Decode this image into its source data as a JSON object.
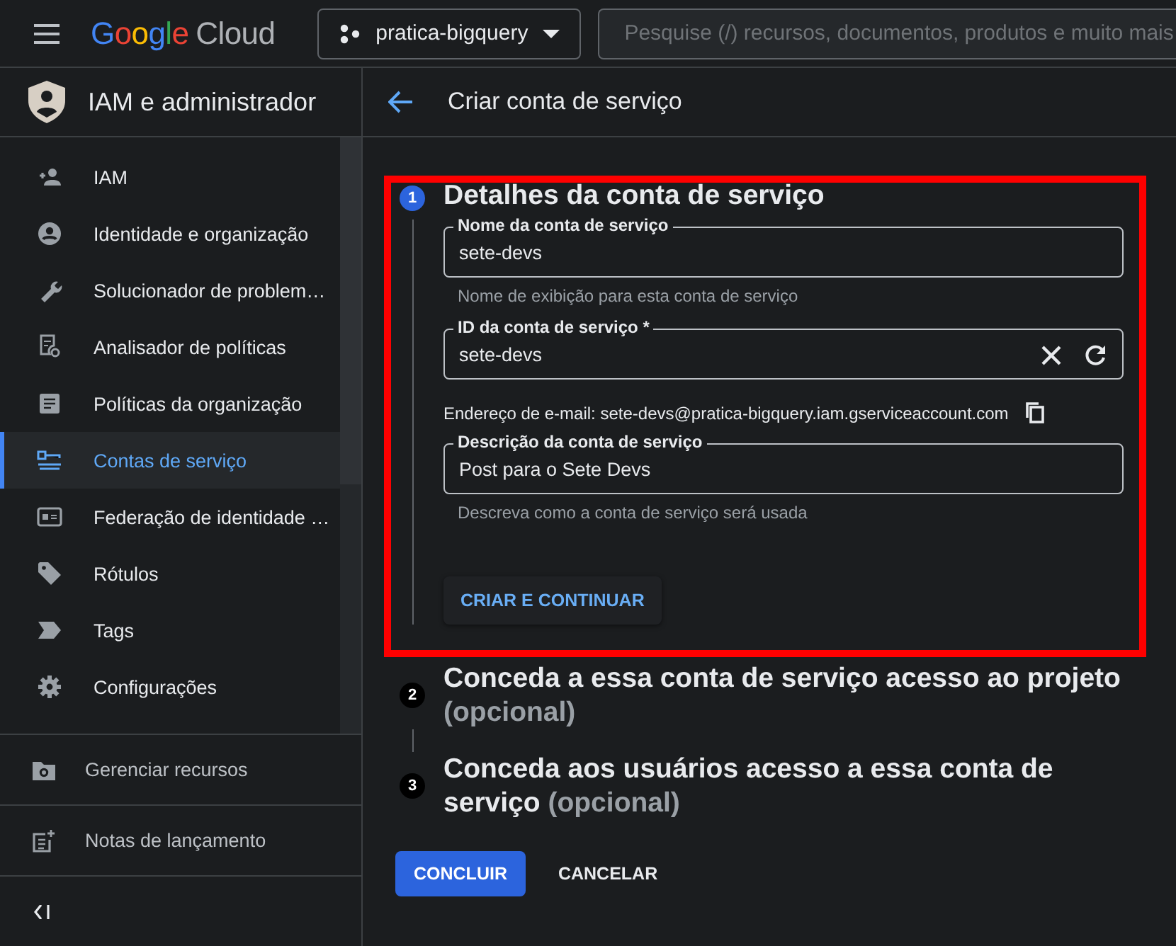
{
  "topbar": {
    "logo_brand": "Google",
    "logo_product": "Cloud",
    "project": "pratica-bigquery",
    "search": {
      "placeholder": "Pesquise (/) recursos, documentos, produtos e muito mais"
    }
  },
  "sidebar": {
    "title": "IAM e administrador",
    "items": [
      {
        "label": "IAM",
        "selected": false
      },
      {
        "label": "Identidade e organização",
        "selected": false
      },
      {
        "label": "Solucionador de problem…",
        "selected": false
      },
      {
        "label": "Analisador de políticas",
        "selected": false
      },
      {
        "label": "Políticas da organização",
        "selected": false
      },
      {
        "label": "Contas de serviço",
        "selected": true
      },
      {
        "label": "Federação de identidade …",
        "selected": false
      },
      {
        "label": "Rótulos",
        "selected": false
      },
      {
        "label": "Tags",
        "selected": false
      },
      {
        "label": "Configurações",
        "selected": false
      }
    ],
    "footer": [
      {
        "label": "Gerenciar recursos"
      },
      {
        "label": "Notas de lançamento"
      }
    ]
  },
  "page": {
    "title": "Criar conta de serviço"
  },
  "steps": [
    {
      "number": "1",
      "title": "Detalhes da conta de serviço",
      "active": true,
      "fields": [
        {
          "kind": "text",
          "label": "Nome da conta de serviço",
          "value": "sete-devs",
          "hint": "Nome de exibição para esta conta de serviço"
        },
        {
          "kind": "clearable",
          "label": "ID da conta de serviço *",
          "value": "sete-devs"
        },
        {
          "kind": "email",
          "text": "Endereço de e-mail: sete-devs@pratica-bigquery.iam.gserviceaccount.com"
        },
        {
          "kind": "text",
          "label": "Descrição da conta de serviço",
          "value": "Post para o Sete Devs",
          "hint": "Descreva como a conta de serviço será usada"
        }
      ],
      "button": "CRIAR E CONTINUAR"
    },
    {
      "number": "2",
      "title": "Conceda a essa conta de serviço acesso ao projeto",
      "suffix": "(opcional)",
      "active": false
    },
    {
      "number": "3",
      "title": "Conceda aos usuários acesso a essa conta de serviço",
      "suffix": "(opcional)",
      "active": false
    }
  ],
  "actions": [
    {
      "label": "CONCLUIR",
      "primary": true
    },
    {
      "label": "CANCELAR",
      "primary": false
    }
  ]
}
